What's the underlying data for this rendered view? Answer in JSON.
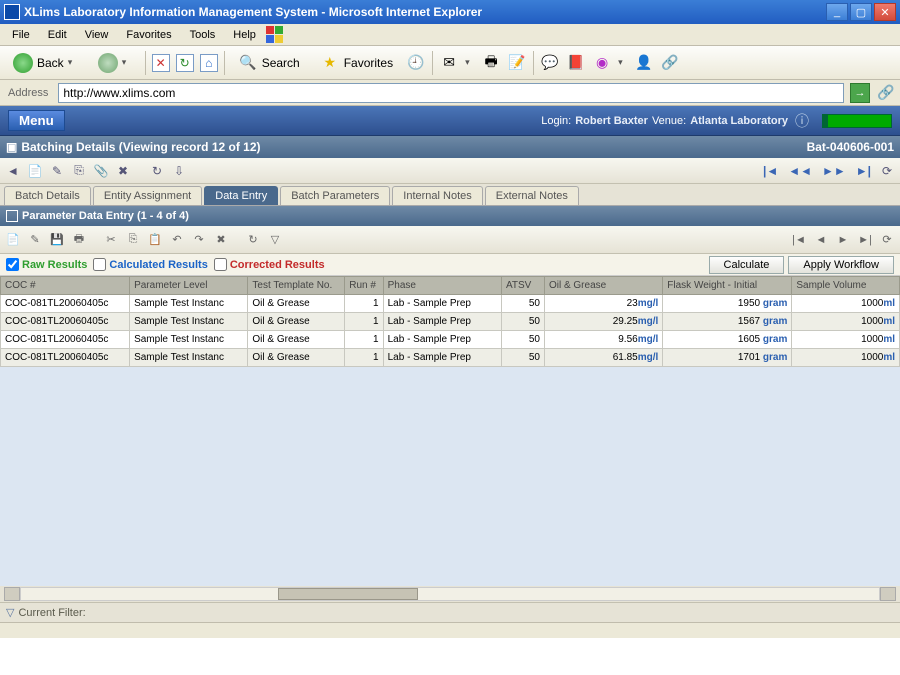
{
  "window": {
    "title": "XLims Laboratory Information Management System - Microsoft Internet Explorer"
  },
  "menu": {
    "file": "File",
    "edit": "Edit",
    "view": "View",
    "favorites": "Favorites",
    "tools": "Tools",
    "help": "Help"
  },
  "toolbar": {
    "back": "Back",
    "search": "Search",
    "favorites": "Favorites"
  },
  "address": {
    "label": "Address",
    "url": "http://www.xlims.com"
  },
  "app_header": {
    "menu_label": "Menu",
    "login_label": "Login:",
    "login_user": "Robert Baxter",
    "venue_label": "Venue:",
    "venue_value": "Atlanta Laboratory"
  },
  "section": {
    "title": "Batching Details (Viewing record 12 of 12)",
    "batch_id": "Bat-040606-001"
  },
  "tabs": {
    "items": [
      {
        "label": "Batch Details"
      },
      {
        "label": "Entity Assignment"
      },
      {
        "label": "Data Entry"
      },
      {
        "label": "Batch Parameters"
      },
      {
        "label": "Internal Notes"
      },
      {
        "label": "External Notes"
      }
    ],
    "active_index": 2
  },
  "subsection": {
    "title": "Parameter Data Entry (1 - 4 of 4)"
  },
  "buttons": {
    "calculate": "Calculate",
    "apply_workflow": "Apply Workflow"
  },
  "result_filters": {
    "raw": "Raw Results",
    "calculated": "Calculated Results",
    "corrected": "Corrected Results",
    "raw_checked": true,
    "calculated_checked": false,
    "corrected_checked": false
  },
  "table": {
    "columns": [
      "COC #",
      "Parameter Level",
      "Test Template No.",
      "Run #",
      "Phase",
      "ATSV",
      "Oil & Grease",
      "Flask Weight - Initial",
      "Sample Volume"
    ],
    "unit_og": "mg/l",
    "unit_fw": "gram",
    "unit_sv": "ml",
    "rows": [
      {
        "coc": "COC-081TL20060405c",
        "param": "Sample Test Instanc",
        "tt": "Oil & Grease",
        "run": "1",
        "phase": "Lab - Sample Prep",
        "atsv": "50",
        "og": "23",
        "fw": "1950",
        "sv": "1000"
      },
      {
        "coc": "COC-081TL20060405c",
        "param": "Sample Test Instanc",
        "tt": "Oil & Grease",
        "run": "1",
        "phase": "Lab - Sample Prep",
        "atsv": "50",
        "og": "29.25",
        "fw": "1567",
        "sv": "1000"
      },
      {
        "coc": "COC-081TL20060405c",
        "param": "Sample Test Instanc",
        "tt": "Oil & Grease",
        "run": "1",
        "phase": "Lab - Sample Prep",
        "atsv": "50",
        "og": "9.56",
        "fw": "1605",
        "sv": "1000"
      },
      {
        "coc": "COC-081TL20060405c",
        "param": "Sample Test Instanc",
        "tt": "Oil & Grease",
        "run": "1",
        "phase": "Lab - Sample Prep",
        "atsv": "50",
        "og": "61.85",
        "fw": "1701",
        "sv": "1000"
      }
    ]
  },
  "footer": {
    "filter_label": "Current Filter:"
  }
}
